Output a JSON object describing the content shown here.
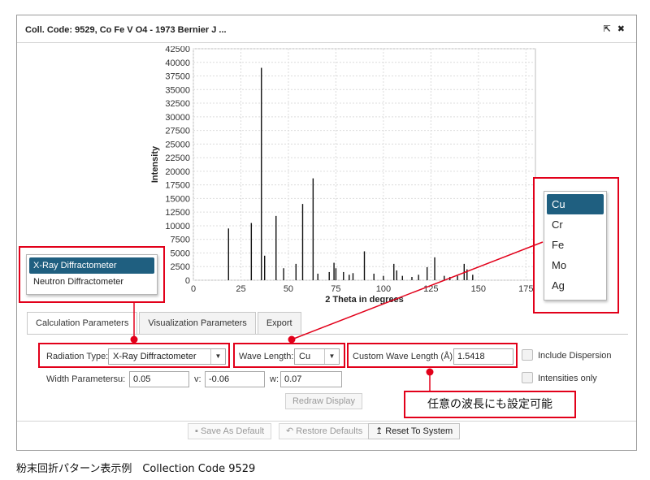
{
  "window": {
    "title": "Coll. Code: 9529, Co Fe V O4 - 1973 Bernier J ...",
    "popout_glyph": "⇱",
    "close_glyph": "✖"
  },
  "chart_data": {
    "type": "bar",
    "xlabel": "2 Theta in degrees",
    "ylabel": "Intensity",
    "xlim": [
      0,
      180
    ],
    "ylim": [
      0,
      42500
    ],
    "x_ticks": [
      0,
      25,
      50,
      75,
      100,
      125,
      150,
      175
    ],
    "y_ticks": [
      0,
      2500,
      5000,
      7500,
      10000,
      12500,
      15000,
      17500,
      20000,
      22500,
      25000,
      27500,
      30000,
      32500,
      35000,
      37500,
      40000,
      42500
    ],
    "grid": true,
    "peaks": [
      [
        18.5,
        9500
      ],
      [
        30.5,
        10500
      ],
      [
        35.8,
        39000
      ],
      [
        37.5,
        4500
      ],
      [
        43.5,
        11800
      ],
      [
        47.5,
        2200
      ],
      [
        54,
        3000
      ],
      [
        57.5,
        14000
      ],
      [
        63,
        18700
      ],
      [
        65.5,
        1200
      ],
      [
        71.5,
        1500
      ],
      [
        74,
        3200
      ],
      [
        75,
        2200
      ],
      [
        79,
        1500
      ],
      [
        82,
        1000
      ],
      [
        84,
        1300
      ],
      [
        90,
        5300
      ],
      [
        95,
        1200
      ],
      [
        100,
        800
      ],
      [
        105.5,
        3000
      ],
      [
        107,
        1800
      ],
      [
        110,
        800
      ],
      [
        115,
        600
      ],
      [
        118.5,
        1000
      ],
      [
        123,
        2400
      ],
      [
        127,
        4200
      ],
      [
        132,
        800
      ],
      [
        135,
        600
      ],
      [
        139,
        800
      ],
      [
        142.5,
        3000
      ],
      [
        144,
        2000
      ],
      [
        147,
        1000
      ]
    ]
  },
  "tabs": {
    "calc": "Calculation Parameters",
    "vis": "Visualization Parameters",
    "export": "Export"
  },
  "form": {
    "radiation_label": "Radiation Type:",
    "radiation_value": "X-Ray Diffractometer",
    "wavelength_label": "Wave Length:",
    "wavelength_value": "Cu",
    "custom_wl_label": "Custom Wave Length (Å):",
    "custom_wl_value": "1.5418",
    "include_dispersion": "Include Dispersion",
    "width_label": "Width Parameters",
    "u_label": "u:",
    "u_value": "0.05",
    "v_label": "v:",
    "v_value": "-0.06",
    "w_label": "w:",
    "w_value": "0.07",
    "intensities_only": "Intensities only",
    "redraw": "Redraw Display"
  },
  "footer": {
    "save_default": "Save As Default",
    "restore_defaults": "Restore Defaults",
    "reset_system": "Reset To System",
    "save_icon": "▪",
    "restore_icon": "↶",
    "reset_icon": "↥"
  },
  "radiation_dropdown": {
    "options": [
      "X-Ray Diffractometer",
      "Neutron Diffractometer"
    ]
  },
  "wavelength_dropdown": {
    "options": [
      "Cu",
      "Cr",
      "Fe",
      "Mo",
      "Ag"
    ]
  },
  "annotation": {
    "note": "任意の波長にも設定可能",
    "caption": "粉末回折パターン表示例　Collection Code 9529"
  },
  "colors": {
    "callout": "#e2001a",
    "selected": "#1f5f80"
  }
}
